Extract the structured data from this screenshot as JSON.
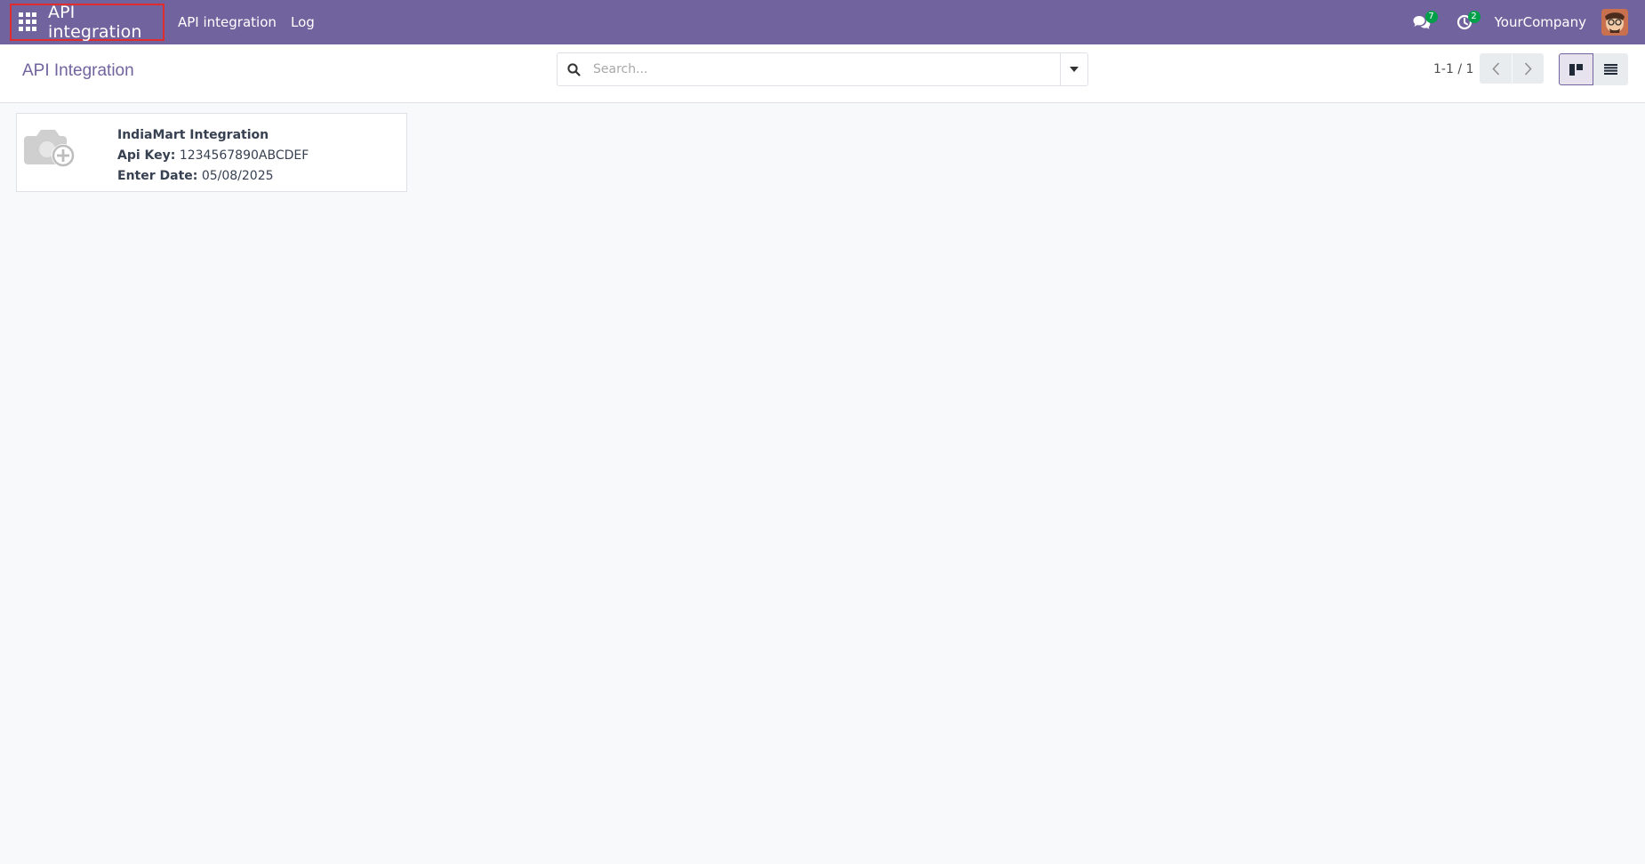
{
  "navbar": {
    "app_name": "API integration",
    "menus": [
      "API integration",
      "Log"
    ],
    "messages_count": "7",
    "activities_count": "2",
    "company": "YourCompany"
  },
  "control_panel": {
    "title": "API Integration",
    "search_placeholder": "Search...",
    "pager": "1-1 / 1"
  },
  "records": [
    {
      "name": "IndiaMart Integration",
      "api_key_label": "Api Key:",
      "api_key": "1234567890ABCDEF",
      "date_label": "Enter Date:",
      "date": "05/08/2025"
    }
  ],
  "colors": {
    "brand": "#71639e",
    "highlight": "#e02c2c",
    "badge": "#00a04a"
  },
  "icons": [
    "apps-grid-icon",
    "messages-icon",
    "activity-clock-icon",
    "search-icon",
    "caret-down-icon",
    "chevron-left-icon",
    "chevron-right-icon",
    "kanban-view-icon",
    "list-view-icon",
    "camera-plus-icon"
  ]
}
